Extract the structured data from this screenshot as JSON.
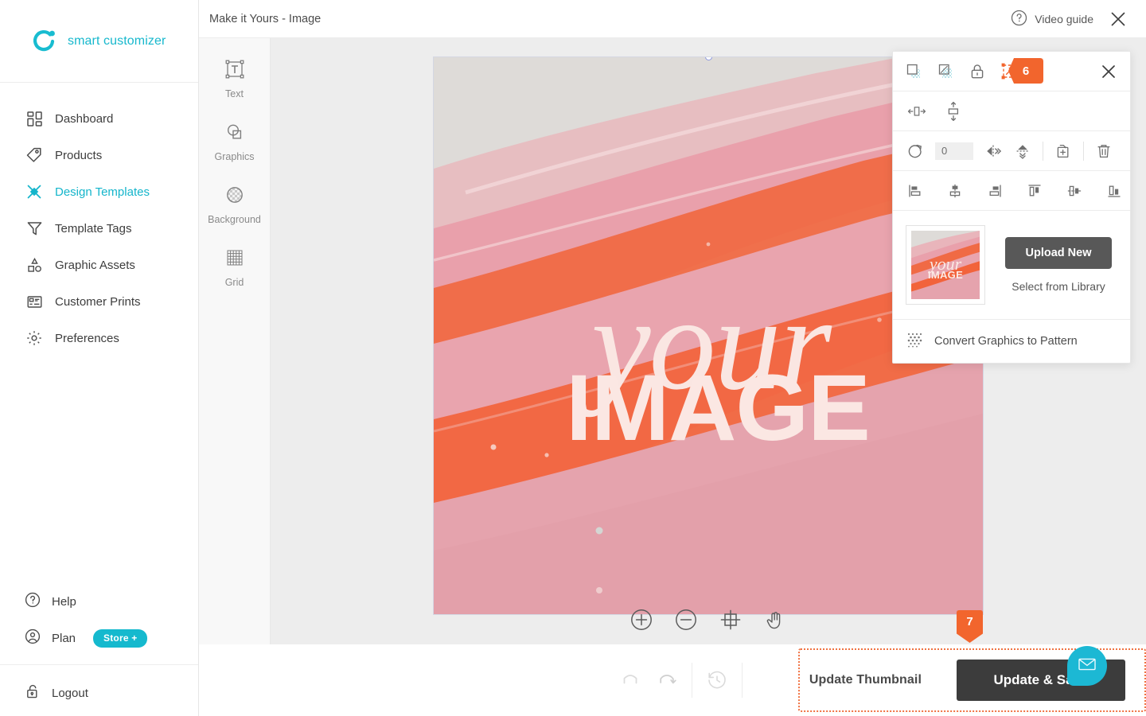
{
  "brand": {
    "name": "smart customizer",
    "logo_icon": "circle-dot-logo",
    "accent": "#17b8cd"
  },
  "sidebar": {
    "items": [
      {
        "label": "Dashboard",
        "icon": "dashboard-grid-icon",
        "active": false
      },
      {
        "label": "Products",
        "icon": "tag-icon",
        "active": false
      },
      {
        "label": "Design Templates",
        "icon": "scissors-cross-icon",
        "active": true
      },
      {
        "label": "Template Tags",
        "icon": "funnel-icon",
        "active": false
      },
      {
        "label": "Graphic Assets",
        "icon": "shapes-icon",
        "active": false
      },
      {
        "label": "Customer Prints",
        "icon": "print-list-icon",
        "active": false
      },
      {
        "label": "Preferences",
        "icon": "gear-icon",
        "active": false
      }
    ],
    "footer": [
      {
        "label": "Help",
        "icon": "question-circle-icon"
      },
      {
        "label": "Plan",
        "icon": "user-circle-icon",
        "badge": "Store +"
      },
      {
        "label": "Logout",
        "icon": "unlock-icon"
      }
    ]
  },
  "topbar": {
    "title": "Make it Yours - Image",
    "video_guide_label": "Video guide",
    "video_guide_icon": "question-circle-icon",
    "close_icon": "close-icon"
  },
  "tool_rail": [
    {
      "label": "Text",
      "icon": "text-box-icon"
    },
    {
      "label": "Graphics",
      "icon": "shapes-overlap-icon"
    },
    {
      "label": "Background",
      "icon": "checker-circle-icon"
    },
    {
      "label": "Grid",
      "icon": "grid-icon"
    }
  ],
  "canvas": {
    "artwork_text_script": "your",
    "artwork_text_block": "IMAGE",
    "zoom_controls": [
      {
        "icon": "zoom-in-icon",
        "name": "zoom-in"
      },
      {
        "icon": "zoom-out-icon",
        "name": "zoom-out"
      },
      {
        "icon": "fit-frame-icon",
        "name": "fit-to-screen"
      },
      {
        "icon": "hand-icon",
        "name": "pan-tool"
      }
    ]
  },
  "panel": {
    "row_mask": [
      {
        "icon": "mask-square-icon",
        "name": "crop-to-shape",
        "active": false
      },
      {
        "icon": "mask-checker-icon",
        "name": "apply-mask",
        "active": false
      },
      {
        "icon": "lock-icon",
        "name": "lock-element",
        "active": false
      },
      {
        "icon": "transform-resize-icon",
        "name": "resize-transform",
        "active": true
      }
    ],
    "close_icon": "close-icon",
    "row_fit": [
      {
        "icon": "fit-horizontal-icon",
        "name": "fit-width"
      },
      {
        "icon": "fit-vertical-icon",
        "name": "fit-height"
      }
    ],
    "rotation": {
      "icon": "rotate-icon",
      "value": "0"
    },
    "row_transform": [
      {
        "icon": "flip-horizontal-icon",
        "name": "flip-horizontal"
      },
      {
        "icon": "flip-vertical-icon",
        "name": "flip-vertical"
      },
      {
        "icon": "duplicate-icon",
        "name": "duplicate-element"
      },
      {
        "icon": "trash-icon",
        "name": "delete-element"
      }
    ],
    "row_align": [
      {
        "icon": "align-left-icon",
        "name": "align-left"
      },
      {
        "icon": "align-center-horizontal-icon",
        "name": "align-center-horizontal"
      },
      {
        "icon": "align-right-icon",
        "name": "align-right"
      },
      {
        "icon": "align-top-icon",
        "name": "align-top"
      },
      {
        "icon": "align-middle-vertical-icon",
        "name": "align-middle-vertical"
      },
      {
        "icon": "align-bottom-icon",
        "name": "align-bottom"
      }
    ],
    "thumbnail": {
      "script": "your",
      "block": "IMAGE"
    },
    "upload_label": "Upload New",
    "library_label": "Select from Library",
    "convert_label": "Convert Graphics to Pattern",
    "convert_icon": "pattern-dots-icon"
  },
  "bottombar": {
    "undo_icon": "undo-icon",
    "redo_icon": "redo-icon",
    "history_icon": "history-clock-icon",
    "thumbnail_button": "Update Thumbnail",
    "save_button": "Update & Save"
  },
  "badges": [
    {
      "value": "6",
      "name": "step-badge-6"
    },
    {
      "value": "7",
      "name": "step-badge-7"
    }
  ],
  "chat_widget": {
    "icon": "envelope-icon",
    "color": "#1cb8d4"
  },
  "colors": {
    "accent_cyan": "#17b8cd",
    "badge_orange": "#f2652d",
    "dark_button": "#3c3c3c",
    "canvas_bg": "#ededed"
  }
}
